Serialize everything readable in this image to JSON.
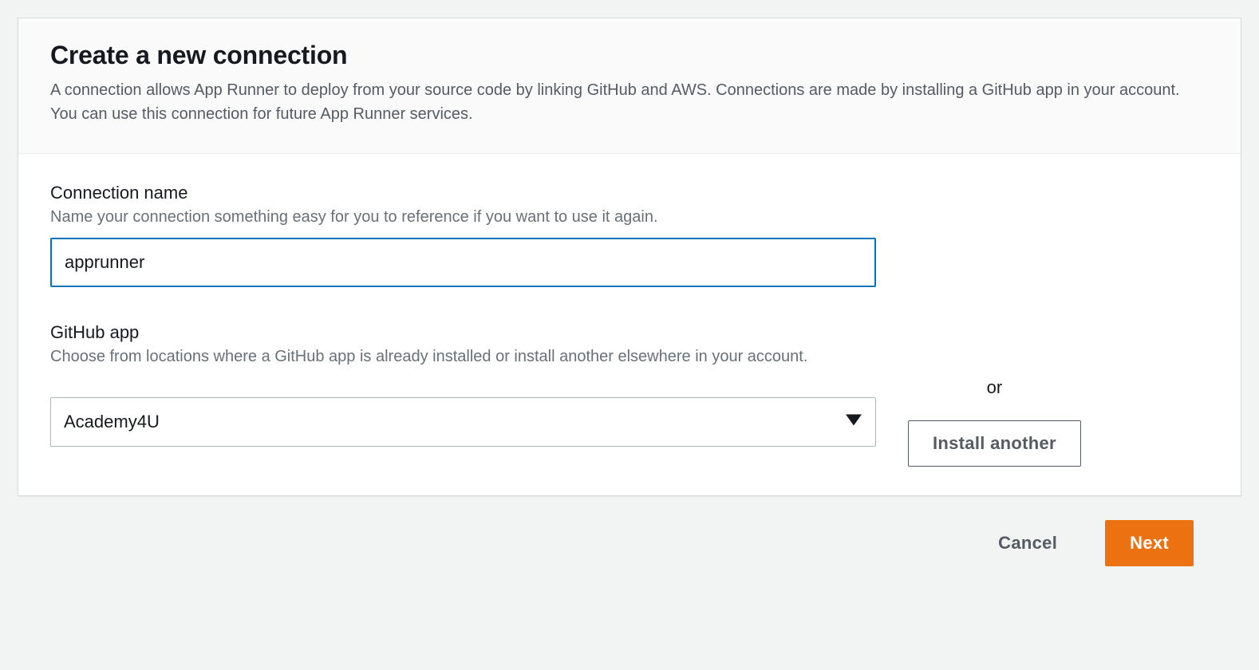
{
  "header": {
    "title": "Create a new connection",
    "description": "A connection allows App Runner to deploy from your source code by linking GitHub and AWS. Connections are made by installing a GitHub app in your account. You can use this connection for future App Runner services."
  },
  "connectionName": {
    "label": "Connection name",
    "hint": "Name your connection something easy for you to reference if you want to use it again.",
    "value": "apprunner"
  },
  "githubApp": {
    "label": "GitHub app",
    "hint": "Choose from locations where a GitHub app is already installed or install another elsewhere in your account.",
    "selected": "Academy4U",
    "orText": "or",
    "installButton": "Install another"
  },
  "footer": {
    "cancel": "Cancel",
    "next": "Next"
  }
}
